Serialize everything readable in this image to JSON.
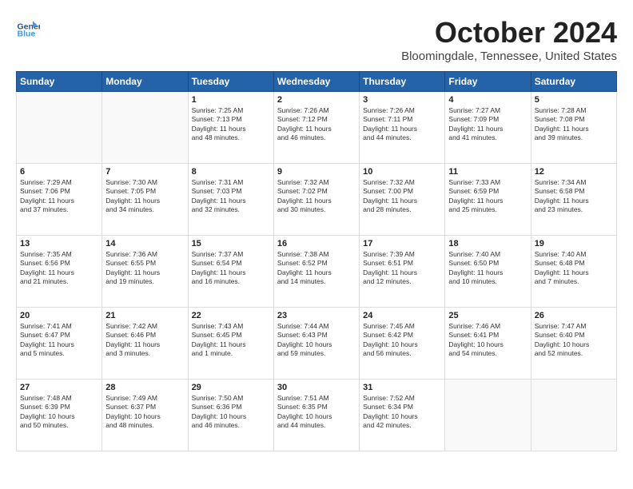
{
  "header": {
    "logo_line1": "General",
    "logo_line2": "Blue",
    "month": "October 2024",
    "location": "Bloomingdale, Tennessee, United States"
  },
  "weekdays": [
    "Sunday",
    "Monday",
    "Tuesday",
    "Wednesday",
    "Thursday",
    "Friday",
    "Saturday"
  ],
  "weeks": [
    [
      {
        "day": "",
        "info": ""
      },
      {
        "day": "",
        "info": ""
      },
      {
        "day": "1",
        "info": "Sunrise: 7:25 AM\nSunset: 7:13 PM\nDaylight: 11 hours\nand 48 minutes."
      },
      {
        "day": "2",
        "info": "Sunrise: 7:26 AM\nSunset: 7:12 PM\nDaylight: 11 hours\nand 46 minutes."
      },
      {
        "day": "3",
        "info": "Sunrise: 7:26 AM\nSunset: 7:11 PM\nDaylight: 11 hours\nand 44 minutes."
      },
      {
        "day": "4",
        "info": "Sunrise: 7:27 AM\nSunset: 7:09 PM\nDaylight: 11 hours\nand 41 minutes."
      },
      {
        "day": "5",
        "info": "Sunrise: 7:28 AM\nSunset: 7:08 PM\nDaylight: 11 hours\nand 39 minutes."
      }
    ],
    [
      {
        "day": "6",
        "info": "Sunrise: 7:29 AM\nSunset: 7:06 PM\nDaylight: 11 hours\nand 37 minutes."
      },
      {
        "day": "7",
        "info": "Sunrise: 7:30 AM\nSunset: 7:05 PM\nDaylight: 11 hours\nand 34 minutes."
      },
      {
        "day": "8",
        "info": "Sunrise: 7:31 AM\nSunset: 7:03 PM\nDaylight: 11 hours\nand 32 minutes."
      },
      {
        "day": "9",
        "info": "Sunrise: 7:32 AM\nSunset: 7:02 PM\nDaylight: 11 hours\nand 30 minutes."
      },
      {
        "day": "10",
        "info": "Sunrise: 7:32 AM\nSunset: 7:00 PM\nDaylight: 11 hours\nand 28 minutes."
      },
      {
        "day": "11",
        "info": "Sunrise: 7:33 AM\nSunset: 6:59 PM\nDaylight: 11 hours\nand 25 minutes."
      },
      {
        "day": "12",
        "info": "Sunrise: 7:34 AM\nSunset: 6:58 PM\nDaylight: 11 hours\nand 23 minutes."
      }
    ],
    [
      {
        "day": "13",
        "info": "Sunrise: 7:35 AM\nSunset: 6:56 PM\nDaylight: 11 hours\nand 21 minutes."
      },
      {
        "day": "14",
        "info": "Sunrise: 7:36 AM\nSunset: 6:55 PM\nDaylight: 11 hours\nand 19 minutes."
      },
      {
        "day": "15",
        "info": "Sunrise: 7:37 AM\nSunset: 6:54 PM\nDaylight: 11 hours\nand 16 minutes."
      },
      {
        "day": "16",
        "info": "Sunrise: 7:38 AM\nSunset: 6:52 PM\nDaylight: 11 hours\nand 14 minutes."
      },
      {
        "day": "17",
        "info": "Sunrise: 7:39 AM\nSunset: 6:51 PM\nDaylight: 11 hours\nand 12 minutes."
      },
      {
        "day": "18",
        "info": "Sunrise: 7:40 AM\nSunset: 6:50 PM\nDaylight: 11 hours\nand 10 minutes."
      },
      {
        "day": "19",
        "info": "Sunrise: 7:40 AM\nSunset: 6:48 PM\nDaylight: 11 hours\nand 7 minutes."
      }
    ],
    [
      {
        "day": "20",
        "info": "Sunrise: 7:41 AM\nSunset: 6:47 PM\nDaylight: 11 hours\nand 5 minutes."
      },
      {
        "day": "21",
        "info": "Sunrise: 7:42 AM\nSunset: 6:46 PM\nDaylight: 11 hours\nand 3 minutes."
      },
      {
        "day": "22",
        "info": "Sunrise: 7:43 AM\nSunset: 6:45 PM\nDaylight: 11 hours\nand 1 minute."
      },
      {
        "day": "23",
        "info": "Sunrise: 7:44 AM\nSunset: 6:43 PM\nDaylight: 10 hours\nand 59 minutes."
      },
      {
        "day": "24",
        "info": "Sunrise: 7:45 AM\nSunset: 6:42 PM\nDaylight: 10 hours\nand 56 minutes."
      },
      {
        "day": "25",
        "info": "Sunrise: 7:46 AM\nSunset: 6:41 PM\nDaylight: 10 hours\nand 54 minutes."
      },
      {
        "day": "26",
        "info": "Sunrise: 7:47 AM\nSunset: 6:40 PM\nDaylight: 10 hours\nand 52 minutes."
      }
    ],
    [
      {
        "day": "27",
        "info": "Sunrise: 7:48 AM\nSunset: 6:39 PM\nDaylight: 10 hours\nand 50 minutes."
      },
      {
        "day": "28",
        "info": "Sunrise: 7:49 AM\nSunset: 6:37 PM\nDaylight: 10 hours\nand 48 minutes."
      },
      {
        "day": "29",
        "info": "Sunrise: 7:50 AM\nSunset: 6:36 PM\nDaylight: 10 hours\nand 46 minutes."
      },
      {
        "day": "30",
        "info": "Sunrise: 7:51 AM\nSunset: 6:35 PM\nDaylight: 10 hours\nand 44 minutes."
      },
      {
        "day": "31",
        "info": "Sunrise: 7:52 AM\nSunset: 6:34 PM\nDaylight: 10 hours\nand 42 minutes."
      },
      {
        "day": "",
        "info": ""
      },
      {
        "day": "",
        "info": ""
      }
    ]
  ]
}
